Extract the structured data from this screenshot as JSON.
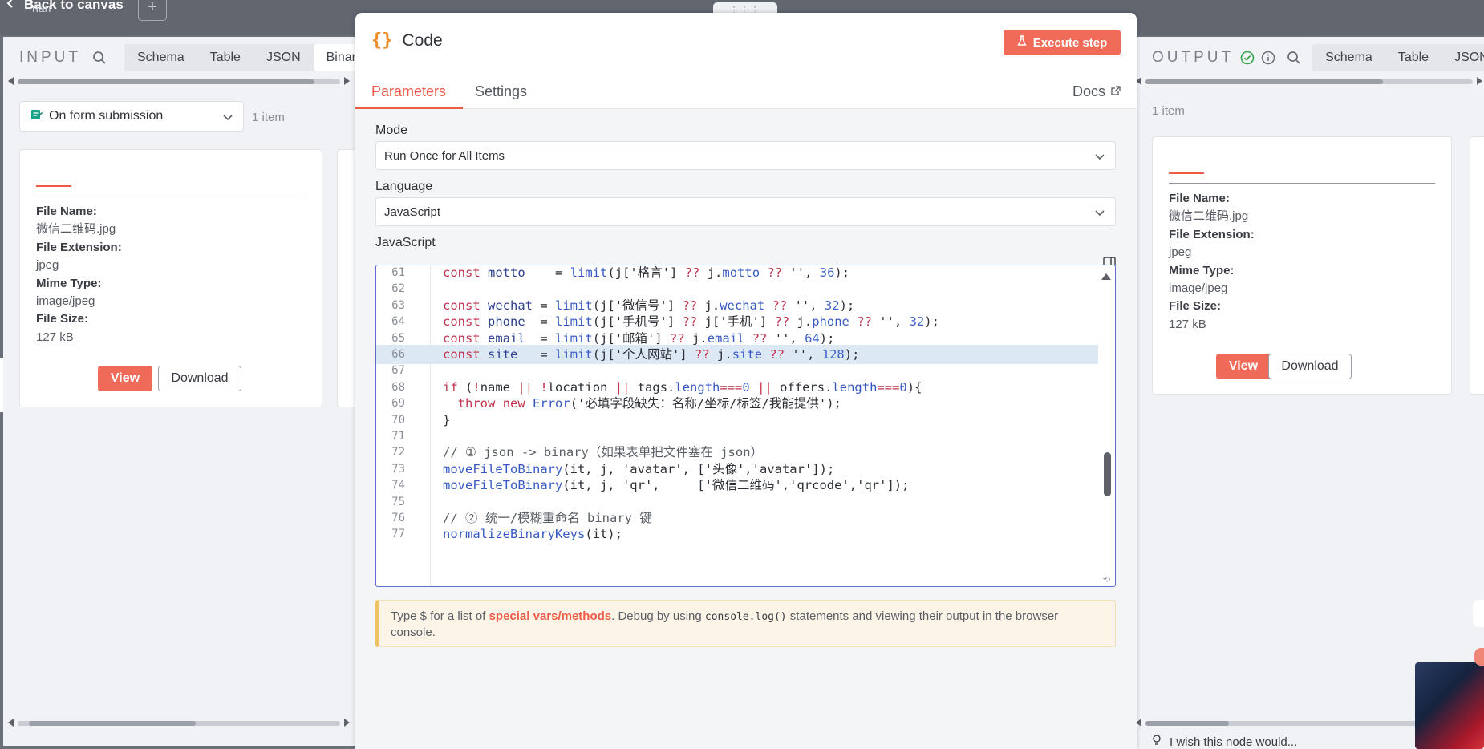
{
  "canvas": {
    "back_label": "Back to canvas",
    "sub_label": "nan",
    "plus": "+",
    "drag_glyph": "⋮⋮⋮"
  },
  "input_panel": {
    "title": "INPUT",
    "tabs": [
      "Schema",
      "Table",
      "JSON",
      "Binary"
    ],
    "active_tab": "Binary",
    "node_select": "On form submission",
    "items_count": "1 item",
    "card": {
      "fields": [
        {
          "key": "File Name:",
          "value": "微信二维码.jpg"
        },
        {
          "key": "File Extension:",
          "value": "jpeg"
        },
        {
          "key": "Mime Type:",
          "value": "image/jpeg"
        },
        {
          "key": "File Size:",
          "value": "127 kB"
        }
      ],
      "view_label": "View",
      "download_label": "Download"
    }
  },
  "output_panel": {
    "title": "OUTPUT",
    "tabs": [
      "Schema",
      "Table",
      "JSON"
    ],
    "items_count": "1 item",
    "card": {
      "fields": [
        {
          "key": "File Name:",
          "value": "微信二维码.jpg"
        },
        {
          "key": "File Extension:",
          "value": "jpeg"
        },
        {
          "key": "Mime Type:",
          "value": "image/jpeg"
        },
        {
          "key": "File Size:",
          "value": "127 kB"
        }
      ],
      "view_label": "View",
      "download_label": "Download"
    },
    "feedback": "I wish this node would..."
  },
  "modal": {
    "icon_glyph": "{}",
    "title": "Code",
    "execute_label": "Execute step",
    "tabs": [
      "Parameters",
      "Settings"
    ],
    "docs_label": "Docs",
    "mode_label": "Mode",
    "mode_value": "Run Once for All Items",
    "language_label": "Language",
    "language_value": "JavaScript",
    "editor_label": "JavaScript",
    "code_lines": [
      {
        "n": "61",
        "t": "const motto    = limit(j['格言'] ?? j.motto ?? '', 36);"
      },
      {
        "n": "62",
        "t": ""
      },
      {
        "n": "63",
        "t": "const wechat = limit(j['微信号'] ?? j.wechat ?? '', 32);"
      },
      {
        "n": "64",
        "t": "const phone  = limit(j['手机号'] ?? j['手机'] ?? j.phone ?? '', 32);"
      },
      {
        "n": "65",
        "t": "const email  = limit(j['邮箱'] ?? j.email ?? '', 64);"
      },
      {
        "n": "66",
        "t": "const site   = limit(j['个人网站'] ?? j.site ?? '', 128);"
      },
      {
        "n": "67",
        "t": ""
      },
      {
        "n": "68",
        "t": "if (!name || !location || tags.length===0 || offers.length===0){"
      },
      {
        "n": "69",
        "t": "  throw new Error('必填字段缺失：名称/坐标/标签/我能提供');"
      },
      {
        "n": "70",
        "t": "}"
      },
      {
        "n": "71",
        "t": ""
      },
      {
        "n": "72",
        "t": "// ① json -> binary（如果表单把文件塞在 json）"
      },
      {
        "n": "73",
        "t": "moveFileToBinary(it, j, 'avatar', ['头像','avatar']);"
      },
      {
        "n": "74",
        "t": "moveFileToBinary(it, j, 'qr',     ['微信二维码','qrcode','qr']);"
      },
      {
        "n": "75",
        "t": ""
      },
      {
        "n": "76",
        "t": "// ② 统一/模糊重命名 binary 键"
      },
      {
        "n": "77",
        "t": "normalizeBinaryKeys(it);"
      }
    ],
    "highlighted_line": "66",
    "hint": {
      "pre": "Type $ for a list of ",
      "link": "special vars/methods",
      "mid": ". Debug by using ",
      "code": "console.log()",
      "post": " statements and viewing their output in the browser console."
    }
  },
  "colors": {
    "accent": "#ef5b49",
    "button": "#f06b58",
    "editor_border": "#5e6bd1",
    "success": "#37a24a"
  }
}
